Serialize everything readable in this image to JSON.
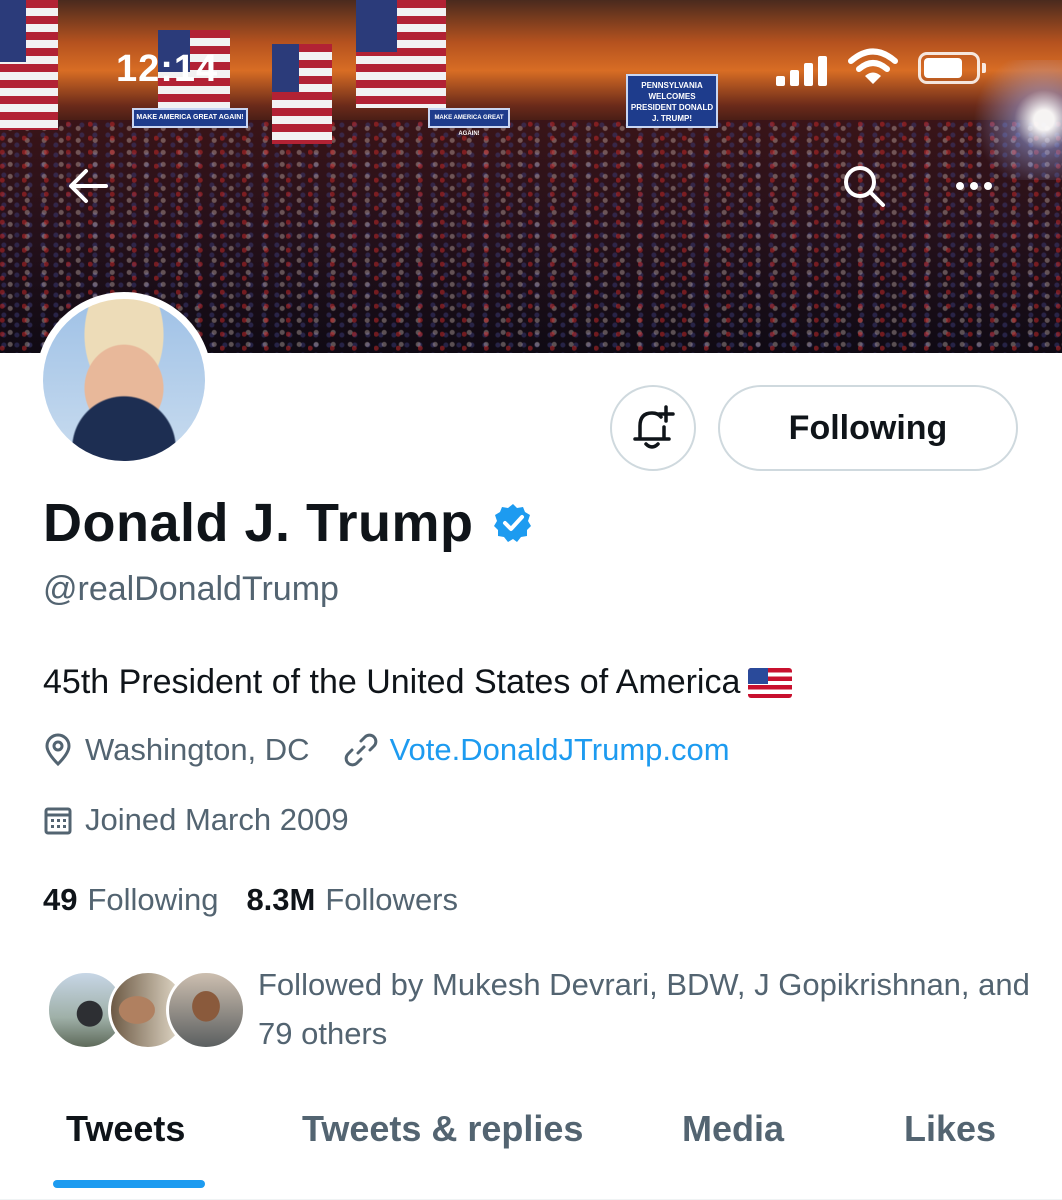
{
  "status_bar": {
    "time": "12:14"
  },
  "banner": {
    "signs": [
      "MAKE AMERICA GREAT AGAIN!",
      "MAKE AMERICA GREAT AGAIN!",
      "PENNSYLVANIA WELCOMES PRESIDENT DONALD J. TRUMP!"
    ]
  },
  "profile": {
    "name": "Donald J. Trump",
    "verified": true,
    "handle": "@realDonaldTrump",
    "bio": "45th President of the United States of America",
    "bio_emoji": "us-flag",
    "location": "Washington, DC",
    "website": "Vote.DonaldJTrump.com",
    "joined": "Joined March 2009",
    "following_count": "49",
    "following_label": "Following",
    "followers_count": "8.3M",
    "followers_label": "Followers",
    "followed_by": "Followed by Mukesh Devrari, BDW, J Gopikrishnan, and 79 others"
  },
  "actions": {
    "notify_icon": "bell-plus-icon",
    "follow_button_label": "Following"
  },
  "tabs": [
    {
      "label": "Tweets",
      "active": true
    },
    {
      "label": "Tweets & replies",
      "active": false
    },
    {
      "label": "Media",
      "active": false
    },
    {
      "label": "Likes",
      "active": false
    }
  ],
  "colors": {
    "accent": "#1d9bf0",
    "text_primary": "#0f1419",
    "text_secondary": "#536471",
    "border": "#cfd9de"
  }
}
